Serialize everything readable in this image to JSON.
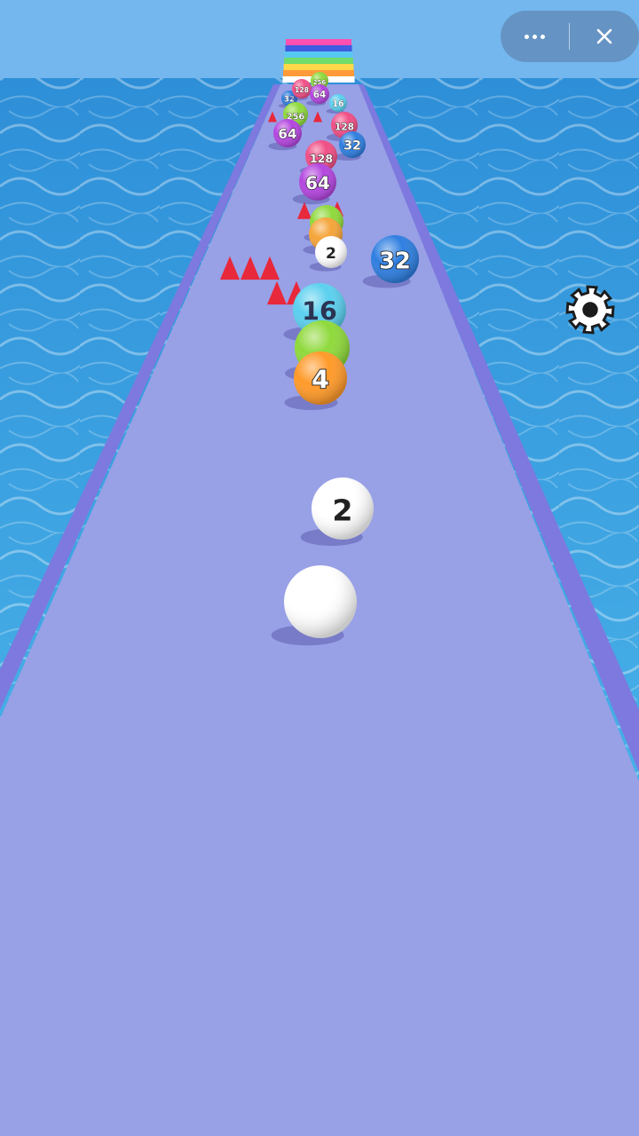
{
  "game": {
    "title": "",
    "colors": {
      "sky": "#6fb4ee",
      "sea": "#3aa6e6",
      "track": "#98a0e6",
      "track_edge": "#7d79de",
      "obstacle": "#e8283b"
    }
  },
  "controls": {
    "more_icon": "more-dots-icon",
    "close_icon": "close-icon",
    "settings_icon": "gear-icon"
  },
  "player": {
    "ball": {
      "label": "",
      "color": "#ffffff"
    }
  },
  "balls": [
    {
      "label": "2",
      "color": "#ffffff",
      "text": "#222222"
    },
    {
      "label": "4",
      "color": "#ff9a2a",
      "text": "#ffffff"
    },
    {
      "label": "",
      "color": "#8fd93c",
      "text": "#ffffff"
    },
    {
      "label": "16",
      "color": "#5cd0ef",
      "text": "#2b3452"
    },
    {
      "label": "32",
      "color": "#2f7fe0",
      "text": "#ffffff"
    },
    {
      "label": "2",
      "color": "#ffffff",
      "text": "#222222"
    },
    {
      "label": "",
      "color": "#f5a53a",
      "text": "#ffffff"
    },
    {
      "label": "",
      "color": "#8fd93c",
      "text": "#ffffff"
    },
    {
      "label": "64",
      "color": "#b446df",
      "text": "#ffffff"
    },
    {
      "label": "128",
      "color": "#f04f86",
      "text": "#ffffff"
    },
    {
      "label": "32",
      "color": "#2f7fe0",
      "text": "#ffffff"
    },
    {
      "label": "64",
      "color": "#b446df",
      "text": "#ffffff"
    },
    {
      "label": "128",
      "color": "#f04f86",
      "text": "#ffffff"
    },
    {
      "label": "256",
      "color": "#8fd93c",
      "text": "#ffffff"
    },
    {
      "label": "16",
      "color": "#5cd0ef",
      "text": "#ffffff"
    },
    {
      "label": "64",
      "color": "#b446df",
      "text": "#ffffff"
    },
    {
      "label": "128",
      "color": "#f04f86",
      "text": "#ffffff"
    },
    {
      "label": "32",
      "color": "#2f7fe0",
      "text": "#ffffff"
    },
    {
      "label": "256",
      "color": "#8fd93c",
      "text": "#ffffff"
    }
  ],
  "finish_stripes": [
    "#ff4fb0",
    "#3f5de0",
    "#58c7f2",
    "#6fdc6b",
    "#ffd84a",
    "#ff9a3a",
    "#ffffff"
  ]
}
